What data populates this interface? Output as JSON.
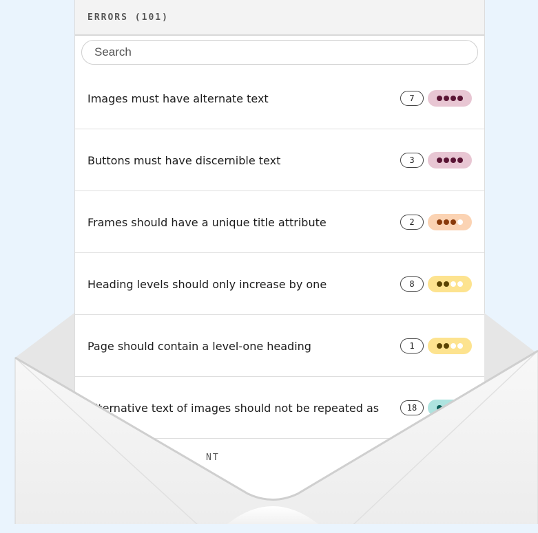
{
  "header": {
    "title": "ERRORS (101)"
  },
  "search": {
    "placeholder": "Search"
  },
  "rows": [
    {
      "label": "Images must have alternate text",
      "count": "7",
      "severity": {
        "bg": "#e8c6d3",
        "dots": [
          "#5a1434",
          "#5a1434",
          "#5a1434",
          "#5a1434"
        ]
      }
    },
    {
      "label": "Buttons must have discernible text",
      "count": "3",
      "severity": {
        "bg": "#e8c6d3",
        "dots": [
          "#5a1434",
          "#5a1434",
          "#5a1434",
          "#5a1434"
        ]
      }
    },
    {
      "label": "Frames should have a unique title attribute",
      "count": "2",
      "severity": {
        "bg": "#fbd3b3",
        "dots": [
          "#8a3a0a",
          "#8a3a0a",
          "#8a3a0a",
          "#ffffff"
        ]
      }
    },
    {
      "label": "Heading levels should only increase by one",
      "count": "8",
      "severity": {
        "bg": "#fde38f",
        "dots": [
          "#5a4400",
          "#5a4400",
          "#ffffff",
          "#ffffff"
        ]
      }
    },
    {
      "label": "Page should contain a level-one heading",
      "count": "1",
      "severity": {
        "bg": "#fde38f",
        "dots": [
          "#5a4400",
          "#5a4400",
          "#ffffff",
          "#ffffff"
        ]
      }
    },
    {
      "label": "Alternative text of images should not be repeated as",
      "count": "18",
      "severity": {
        "bg": "#aee3df",
        "dots": [
          "#0b5e58",
          "#ffffff",
          "#ffffff",
          "#ffffff"
        ]
      }
    }
  ],
  "next_section": {
    "label": "NT"
  }
}
